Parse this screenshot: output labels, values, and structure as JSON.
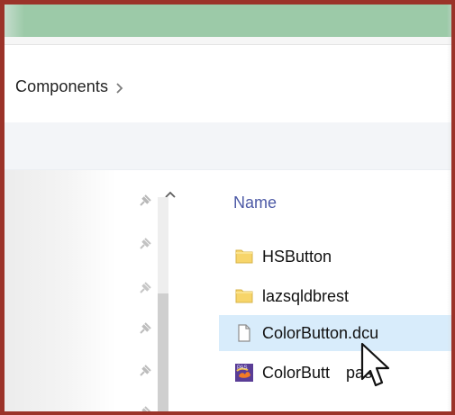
{
  "breadcrumb": {
    "current": "Components"
  },
  "columns": {
    "name": "Name"
  },
  "files": [
    {
      "label": "HSButton",
      "icon": "folder-icon"
    },
    {
      "label": "lazsqldbrest",
      "icon": "folder-icon"
    },
    {
      "label": "ColorButton.dcu",
      "icon": "document-icon",
      "selected": true
    },
    {
      "label": "ColorButt",
      "label_suffix": "pas",
      "icon": "pascal-source-icon"
    }
  ],
  "colors": {
    "frame": "#9b3329",
    "titlebar": "#9ccaa8",
    "header_text": "#4d5aa6",
    "selection": "#d8ecfb"
  }
}
